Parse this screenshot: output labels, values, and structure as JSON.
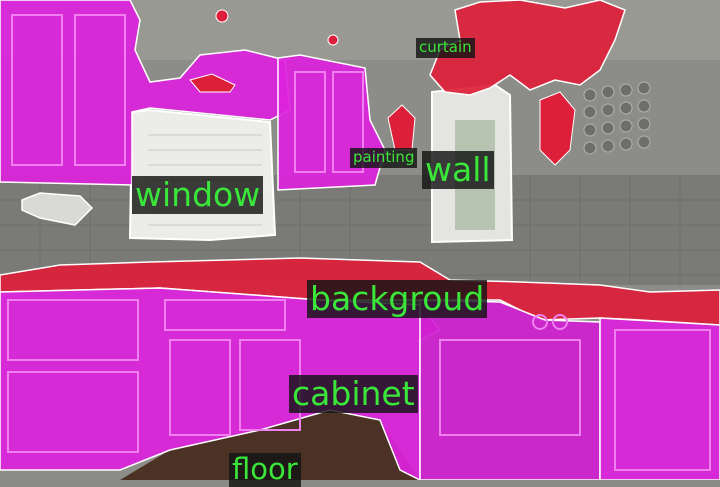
{
  "labels": {
    "curtain": "curtain",
    "painting": "painting",
    "wall": "wall",
    "window": "window",
    "background": "backgroud",
    "cabinet": "cabinet",
    "floor": "floor"
  },
  "colors": {
    "cabinet_mask": "#dd22dd",
    "curtain_mask": "#dd1f3a",
    "wall": "#8a8a86",
    "tile_backsplash": "#7c7c78",
    "window": "#e9e9e6",
    "floor": "#4a3124",
    "label_bg": "#141414",
    "label_text": "#39e639"
  }
}
